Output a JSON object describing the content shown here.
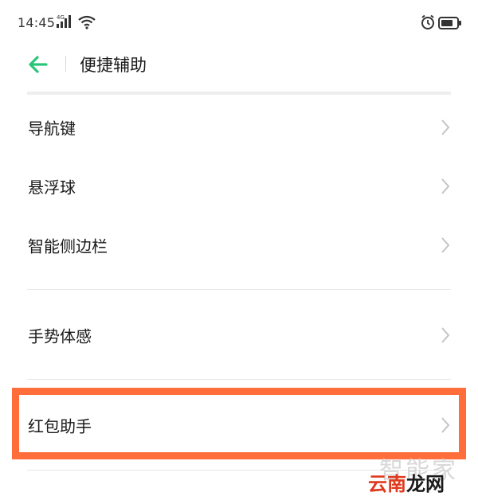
{
  "status_bar": {
    "time": "14:45",
    "network": "4G",
    "icons": [
      "signal-icon",
      "wifi-icon",
      "alarm-icon",
      "battery-icon"
    ]
  },
  "header": {
    "back_icon": "arrow-left-icon",
    "title": "便捷辅助"
  },
  "list": {
    "item_nav": "导航键",
    "item_float": "悬浮球",
    "item_sidebar": "智能侧边栏",
    "item_gesture": "手势体感",
    "item_redpacket": "红包助手"
  },
  "watermark": {
    "gray_text": "智能家",
    "brand_part1": "云南",
    "brand_part2": "龙网"
  },
  "colors": {
    "accent": "#2bc57a",
    "highlight": "#ff6d3b",
    "watermark_red": "#e03a1e"
  }
}
